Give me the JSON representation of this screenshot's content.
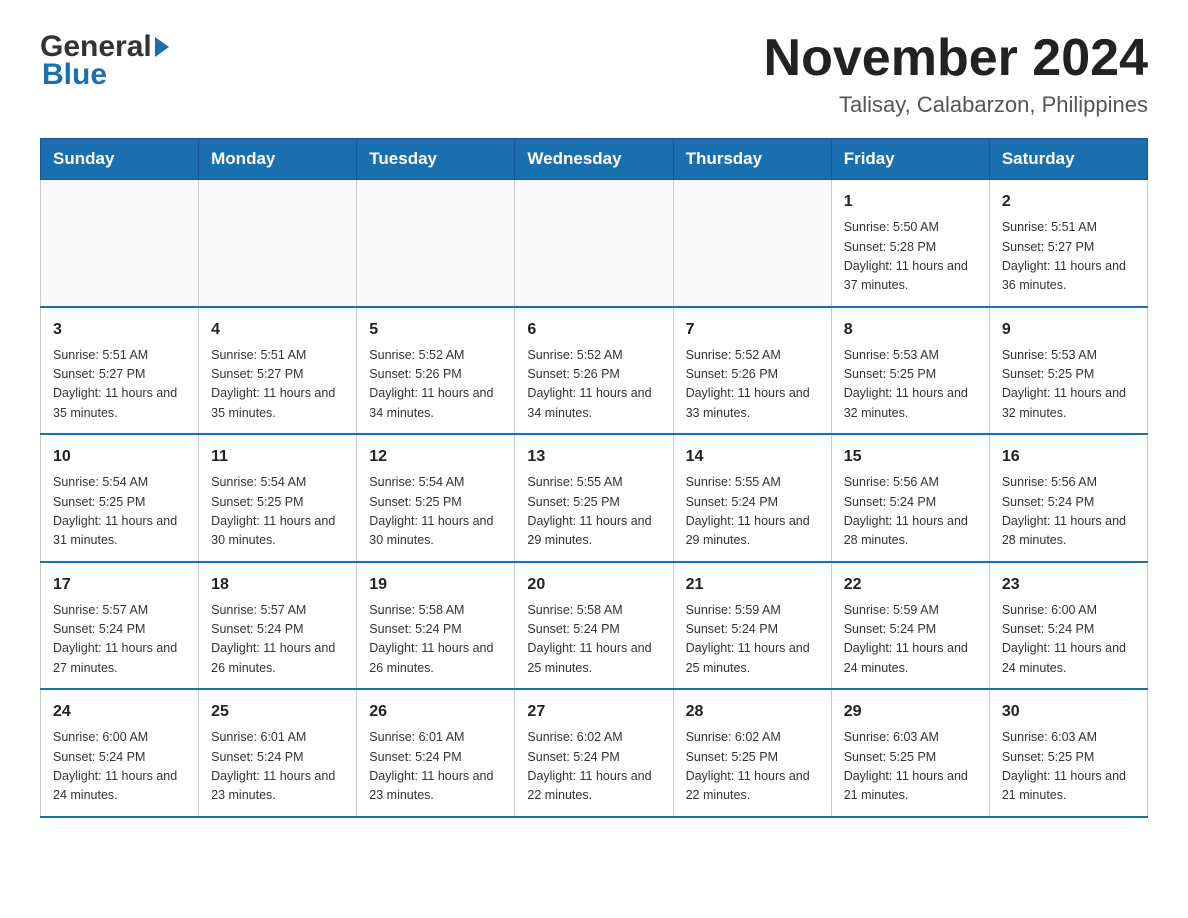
{
  "header": {
    "logo_general": "General",
    "logo_blue": "Blue",
    "month_title": "November 2024",
    "location": "Talisay, Calabarzon, Philippines"
  },
  "columns": [
    "Sunday",
    "Monday",
    "Tuesday",
    "Wednesday",
    "Thursday",
    "Friday",
    "Saturday"
  ],
  "weeks": [
    [
      {
        "day": "",
        "info": ""
      },
      {
        "day": "",
        "info": ""
      },
      {
        "day": "",
        "info": ""
      },
      {
        "day": "",
        "info": ""
      },
      {
        "day": "",
        "info": ""
      },
      {
        "day": "1",
        "info": "Sunrise: 5:50 AM\nSunset: 5:28 PM\nDaylight: 11 hours and 37 minutes."
      },
      {
        "day": "2",
        "info": "Sunrise: 5:51 AM\nSunset: 5:27 PM\nDaylight: 11 hours and 36 minutes."
      }
    ],
    [
      {
        "day": "3",
        "info": "Sunrise: 5:51 AM\nSunset: 5:27 PM\nDaylight: 11 hours and 35 minutes."
      },
      {
        "day": "4",
        "info": "Sunrise: 5:51 AM\nSunset: 5:27 PM\nDaylight: 11 hours and 35 minutes."
      },
      {
        "day": "5",
        "info": "Sunrise: 5:52 AM\nSunset: 5:26 PM\nDaylight: 11 hours and 34 minutes."
      },
      {
        "day": "6",
        "info": "Sunrise: 5:52 AM\nSunset: 5:26 PM\nDaylight: 11 hours and 34 minutes."
      },
      {
        "day": "7",
        "info": "Sunrise: 5:52 AM\nSunset: 5:26 PM\nDaylight: 11 hours and 33 minutes."
      },
      {
        "day": "8",
        "info": "Sunrise: 5:53 AM\nSunset: 5:25 PM\nDaylight: 11 hours and 32 minutes."
      },
      {
        "day": "9",
        "info": "Sunrise: 5:53 AM\nSunset: 5:25 PM\nDaylight: 11 hours and 32 minutes."
      }
    ],
    [
      {
        "day": "10",
        "info": "Sunrise: 5:54 AM\nSunset: 5:25 PM\nDaylight: 11 hours and 31 minutes."
      },
      {
        "day": "11",
        "info": "Sunrise: 5:54 AM\nSunset: 5:25 PM\nDaylight: 11 hours and 30 minutes."
      },
      {
        "day": "12",
        "info": "Sunrise: 5:54 AM\nSunset: 5:25 PM\nDaylight: 11 hours and 30 minutes."
      },
      {
        "day": "13",
        "info": "Sunrise: 5:55 AM\nSunset: 5:25 PM\nDaylight: 11 hours and 29 minutes."
      },
      {
        "day": "14",
        "info": "Sunrise: 5:55 AM\nSunset: 5:24 PM\nDaylight: 11 hours and 29 minutes."
      },
      {
        "day": "15",
        "info": "Sunrise: 5:56 AM\nSunset: 5:24 PM\nDaylight: 11 hours and 28 minutes."
      },
      {
        "day": "16",
        "info": "Sunrise: 5:56 AM\nSunset: 5:24 PM\nDaylight: 11 hours and 28 minutes."
      }
    ],
    [
      {
        "day": "17",
        "info": "Sunrise: 5:57 AM\nSunset: 5:24 PM\nDaylight: 11 hours and 27 minutes."
      },
      {
        "day": "18",
        "info": "Sunrise: 5:57 AM\nSunset: 5:24 PM\nDaylight: 11 hours and 26 minutes."
      },
      {
        "day": "19",
        "info": "Sunrise: 5:58 AM\nSunset: 5:24 PM\nDaylight: 11 hours and 26 minutes."
      },
      {
        "day": "20",
        "info": "Sunrise: 5:58 AM\nSunset: 5:24 PM\nDaylight: 11 hours and 25 minutes."
      },
      {
        "day": "21",
        "info": "Sunrise: 5:59 AM\nSunset: 5:24 PM\nDaylight: 11 hours and 25 minutes."
      },
      {
        "day": "22",
        "info": "Sunrise: 5:59 AM\nSunset: 5:24 PM\nDaylight: 11 hours and 24 minutes."
      },
      {
        "day": "23",
        "info": "Sunrise: 6:00 AM\nSunset: 5:24 PM\nDaylight: 11 hours and 24 minutes."
      }
    ],
    [
      {
        "day": "24",
        "info": "Sunrise: 6:00 AM\nSunset: 5:24 PM\nDaylight: 11 hours and 24 minutes."
      },
      {
        "day": "25",
        "info": "Sunrise: 6:01 AM\nSunset: 5:24 PM\nDaylight: 11 hours and 23 minutes."
      },
      {
        "day": "26",
        "info": "Sunrise: 6:01 AM\nSunset: 5:24 PM\nDaylight: 11 hours and 23 minutes."
      },
      {
        "day": "27",
        "info": "Sunrise: 6:02 AM\nSunset: 5:24 PM\nDaylight: 11 hours and 22 minutes."
      },
      {
        "day": "28",
        "info": "Sunrise: 6:02 AM\nSunset: 5:25 PM\nDaylight: 11 hours and 22 minutes."
      },
      {
        "day": "29",
        "info": "Sunrise: 6:03 AM\nSunset: 5:25 PM\nDaylight: 11 hours and 21 minutes."
      },
      {
        "day": "30",
        "info": "Sunrise: 6:03 AM\nSunset: 5:25 PM\nDaylight: 11 hours and 21 minutes."
      }
    ]
  ]
}
